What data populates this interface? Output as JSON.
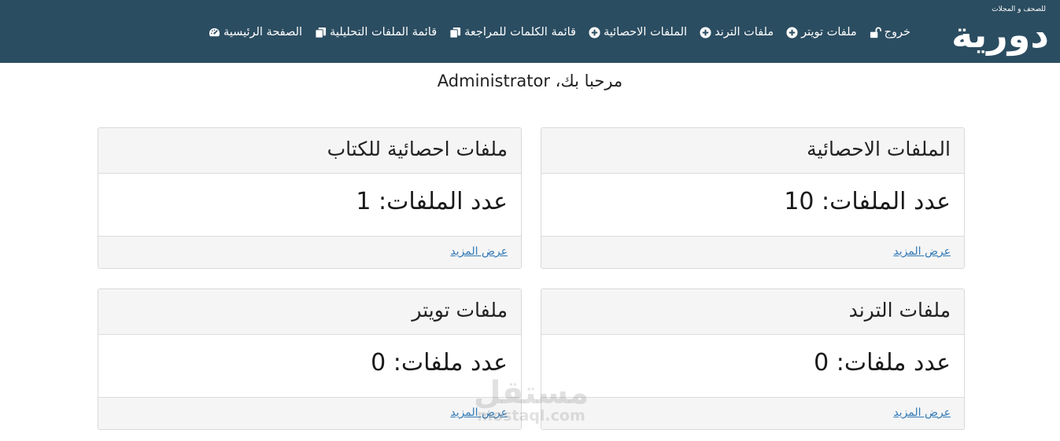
{
  "brand": {
    "logo_text": "دورية",
    "tagline": "للصحف و المجلات"
  },
  "nav": {
    "items": [
      {
        "label": "الصفحة الرئيسية",
        "icon": "dashboard-icon"
      },
      {
        "label": "قائمة الملفات التحليلية",
        "icon": "copy-icon"
      },
      {
        "label": "قائمة الكلمات للمراجعة",
        "icon": "copy-icon"
      },
      {
        "label": "الملفات الاحصائية",
        "icon": "plus-circle-icon"
      },
      {
        "label": "ملفات الترند",
        "icon": "plus-circle-icon"
      },
      {
        "label": "ملفات تويتر",
        "icon": "plus-circle-icon"
      },
      {
        "label": "خروج",
        "icon": "unlock-icon"
      }
    ]
  },
  "welcome": "مرحبا بك، Administrator",
  "cards": [
    {
      "title": "الملفات الاحصائية",
      "count_text": "عدد الملفات: 10",
      "link": "عرض المزيد"
    },
    {
      "title": "ملفات احصائية للكتاب",
      "count_text": "عدد الملفات: 1",
      "link": "عرض المزيد"
    },
    {
      "title": "ملفات الترند",
      "count_text": "عدد ملفات: 0",
      "link": "عرض المزيد"
    },
    {
      "title": "ملفات تويتر",
      "count_text": "عدد ملفات: 0",
      "link": "عرض المزيد"
    }
  ],
  "watermark": {
    "arabic": "مستقل",
    "latin": "mostaql.com"
  },
  "colors": {
    "navbar": "#2b4d61",
    "link": "#337ab7",
    "card_header": "#f5f5f5"
  }
}
